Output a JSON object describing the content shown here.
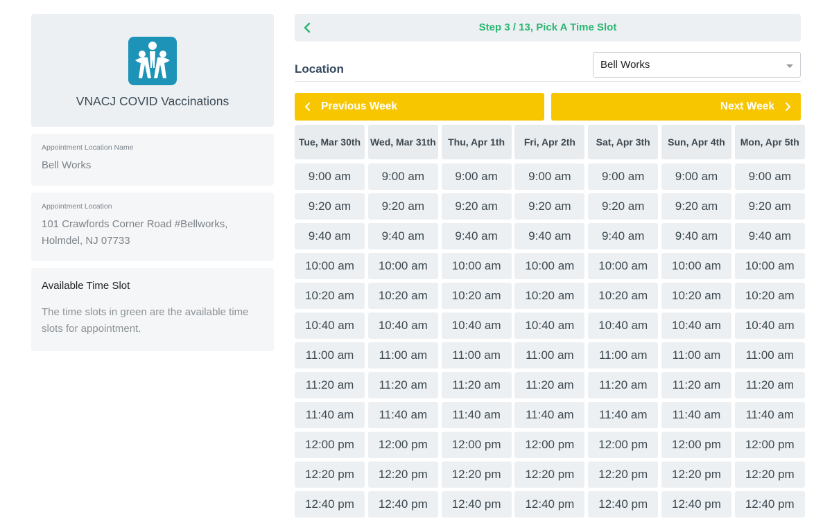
{
  "org": {
    "name": "VNACJ COVID Vaccinations",
    "logo_icon": "family-logo-icon",
    "logo_color": "#1d93b8"
  },
  "location_name_card": {
    "label": "Appointment Location Name",
    "value": "Bell Works"
  },
  "address_card": {
    "label": "Appointment Location",
    "line1": "101 Crawfords Corner Road #Bellworks,",
    "line2": "Holmdel, NJ 07733"
  },
  "time_slot_card": {
    "title": "Available Time Slot",
    "line1": "The time slots in green are the available time",
    "line2": "slots for appointment."
  },
  "step": {
    "text": "Step 3 / 13, Pick A Time Slot",
    "back_icon": "chevron-left-icon",
    "color": "#2bb673"
  },
  "location": {
    "label": "Location",
    "selected": "Bell Works"
  },
  "week_nav": {
    "prev": "Previous Week",
    "next": "Next Week",
    "color": "#f7c600"
  },
  "days": [
    "Tue, Mar 30th",
    "Wed, Mar 31th",
    "Thu, Apr 1th",
    "Fri, Apr 2th",
    "Sat, Apr 3th",
    "Sun, Apr 4th",
    "Mon, Apr 5th"
  ],
  "times": [
    "9:00 am",
    "9:20 am",
    "9:40 am",
    "10:00 am",
    "10:20 am",
    "10:40 am",
    "11:00 am",
    "11:20 am",
    "11:40 am",
    "12:00 pm",
    "12:20 pm",
    "12:40 pm"
  ]
}
